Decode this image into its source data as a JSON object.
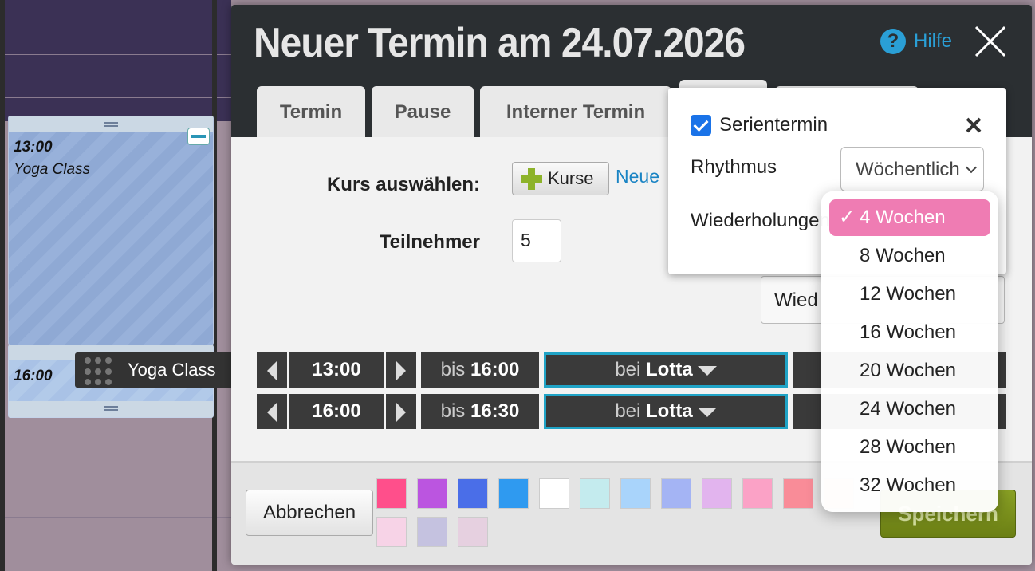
{
  "calendar": {
    "event1": {
      "time": "13:00",
      "title": "Yoga Class"
    },
    "event2": {
      "time": "16:00"
    },
    "drag_label": "Yoga Class"
  },
  "modal": {
    "title": "Neuer Termin am 24.07.2026",
    "help_label": "Hilfe",
    "tabs": [
      "Termin",
      "Pause",
      "Interner Termin"
    ],
    "form": {
      "kurs_label": "Kurs auswählen:",
      "kurse_button": "Kurse",
      "neue_link": "Neue",
      "teilnehmer_label": "Teilnehmer",
      "teilnehmer_value": "5",
      "wied_button": "Wied"
    },
    "rows": [
      {
        "start": "13:00",
        "bis_prefix": "bis",
        "end": "16:00",
        "bei_prefix": "bei",
        "person": "Lotta"
      },
      {
        "start": "16:00",
        "bis_prefix": "bis",
        "end": "16:30",
        "bei_prefix": "bei",
        "person": "Lotta"
      }
    ],
    "footer": {
      "cancel_label": "Abbrechen",
      "save_label": "Speichern",
      "swatches": [
        "#ff4f8b",
        "#bb55e0",
        "#4a6ee8",
        "#2f9af0",
        "#ffffff",
        "#c4ebee",
        "#a9d4fb",
        "#a4b4f4",
        "#e2b4ee",
        "#fba2c6",
        "#f98c98",
        "#f7c8a8",
        "#f7d3e7",
        "#c5c2e0",
        "#e6d0e0"
      ]
    }
  },
  "popover": {
    "serientermin_label": "Serientermin",
    "serientermin_checked": true,
    "rhythmus_label": "Rhythmus",
    "rhythmus_value": "Wöchentlich",
    "wiederholung_label": "Wiederholungen",
    "options": [
      "4 Wochen",
      "8 Wochen",
      "12 Wochen",
      "16 Wochen",
      "20 Wochen",
      "24 Wochen",
      "28 Wochen",
      "32 Wochen"
    ],
    "selected_index": 0,
    "tick": "✓"
  }
}
